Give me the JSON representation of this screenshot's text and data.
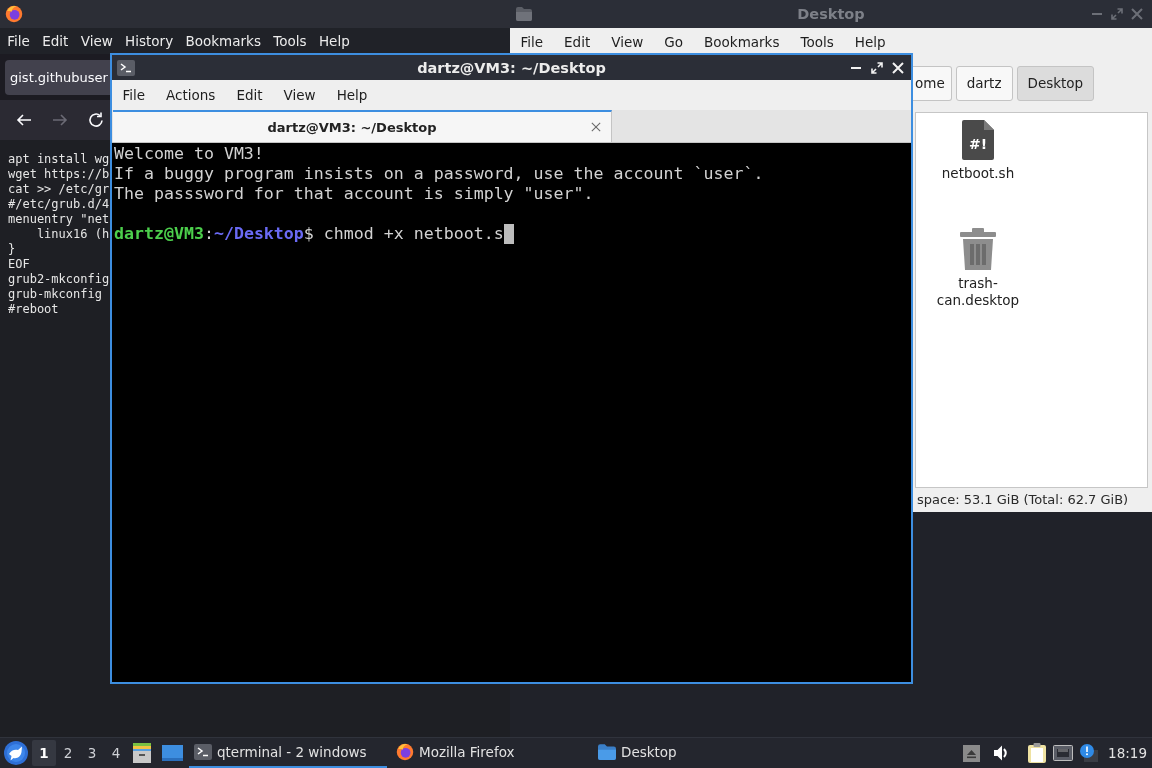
{
  "browser": {
    "menu": [
      "File",
      "Edit",
      "View",
      "History",
      "Bookmarks",
      "Tools",
      "Help"
    ],
    "tab": {
      "title": "gist.githubuser"
    },
    "navigation": {
      "forward_disabled": true
    },
    "page_lines": [
      "apt install wg",
      "wget https://b",
      "cat >> /etc/gr",
      "#/etc/grub.d/4",
      "menuentry \"net",
      "    linux16 (h",
      "}",
      "EOF",
      "grub2-mkconfig",
      "grub-mkconfig",
      "#reboot"
    ]
  },
  "file_manager": {
    "window": {
      "title": "Desktop",
      "active": false
    },
    "menu": [
      "File",
      "Edit",
      "View",
      "Go",
      "Bookmarks",
      "Tools",
      "Help"
    ],
    "path": [
      {
        "label": "ome",
        "selected": false
      },
      {
        "label": "dartz",
        "selected": false
      },
      {
        "label": "Desktop",
        "selected": true
      }
    ],
    "files": [
      {
        "name": "netboot.sh",
        "kind": "script",
        "badge": "#!"
      },
      {
        "name": "trash-can.desktop",
        "kind": "trash"
      }
    ],
    "status": "space: 53.1 GiB (Total: 62.7 GiB)"
  },
  "terminal": {
    "window": {
      "title": "dartz@VM3: ~/Desktop",
      "active": true
    },
    "menu": [
      "File",
      "Actions",
      "Edit",
      "View",
      "Help"
    ],
    "tabs": [
      {
        "title": "dartz@VM3: ~/Desktop",
        "selected": true
      }
    ],
    "output": [
      "Welcome to VM3!",
      "If a buggy program insists on a password, use the account `user`.",
      "The passsword for that account is simply \"user\"."
    ],
    "prompt": {
      "user": "dartz@VM3",
      "separator": ":",
      "path": "~/Desktop",
      "symbol": "$",
      "command": "chmod +x netboot.s"
    }
  },
  "taskbar": {
    "desktops": [
      {
        "label": "1",
        "selected": true
      },
      {
        "label": "2",
        "selected": false
      },
      {
        "label": "3",
        "selected": false
      },
      {
        "label": "4",
        "selected": false
      }
    ],
    "tasks": [
      {
        "label": "qterminal - 2 windows",
        "kind": "terminal",
        "selected": true
      },
      {
        "label": "Mozilla Firefox",
        "kind": "browser",
        "selected": false
      },
      {
        "label": "Desktop",
        "kind": "folder",
        "selected": false
      }
    ],
    "clock": "18:19"
  }
}
